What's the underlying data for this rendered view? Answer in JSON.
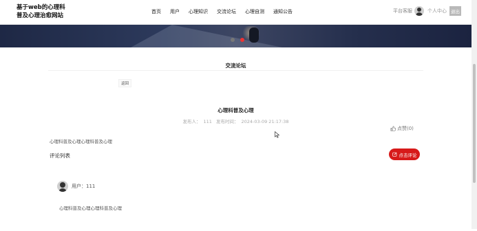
{
  "header": {
    "site_title_line1": "基于web的心理科",
    "site_title_line2": "普及心理治愈网站",
    "nav": [
      {
        "label": "首页"
      },
      {
        "label": "用户"
      },
      {
        "label": "心理知识"
      },
      {
        "label": "交流论坛"
      },
      {
        "label": "心理自测"
      },
      {
        "label": "通知公告"
      }
    ],
    "service_label": "平台客服",
    "user_center_label": "个人中心",
    "logout_label": "退出"
  },
  "banner": {
    "carousel_dots": 2,
    "active_dot": 2
  },
  "forum": {
    "section_title": "交流论坛",
    "back_label": "返回",
    "post_title": "心理科普及心理",
    "publisher_label": "发布人：",
    "publisher": "111",
    "publish_time_label": "发布时间：",
    "publish_time": "2024-03-09 21:17:38",
    "like_label": "点赞(0)",
    "content": "心理科普及心理心理科普及心理",
    "comments_title": "评论列表",
    "comment_button_label": "点击评论"
  },
  "comments": [
    {
      "user_label": "用户：111",
      "text": "心理科普及心理心理科普及心理"
    }
  ],
  "colors": {
    "accent": "#d71a1a",
    "banner_dark": "#1e2845"
  },
  "icons": {
    "like": "thumbs-up-icon",
    "comment": "edit-icon",
    "avatar": "user-avatar-icon"
  }
}
